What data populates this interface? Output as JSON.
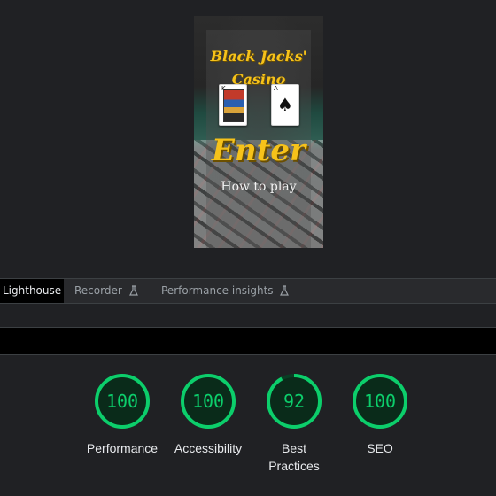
{
  "preview": {
    "brand_line1": "Black Jacks'",
    "brand_line2": "Casino",
    "enter_label": "Enter",
    "how_to_play_label": "How to play",
    "card_king_index": "K",
    "card_ace_index": "A",
    "card_ace_suit": "♠"
  },
  "tabs": [
    {
      "label": "Lighthouse",
      "active": true
    },
    {
      "label": "Recorder",
      "icon": "flask-icon"
    },
    {
      "label": "Performance insights",
      "icon": "flask-icon"
    }
  ],
  "scores": [
    {
      "value": "100",
      "label": "Performance",
      "fraction": 1.0
    },
    {
      "value": "100",
      "label": "Accessibility",
      "fraction": 1.0
    },
    {
      "value": "92",
      "label": "Best Practices",
      "fraction": 0.92
    },
    {
      "value": "100",
      "label": "SEO",
      "fraction": 1.0
    }
  ],
  "colors": {
    "pass": "#0cce6b",
    "pass_track": "#0a3d24",
    "brand_gold": "#f6c21a",
    "background": "#202124"
  }
}
